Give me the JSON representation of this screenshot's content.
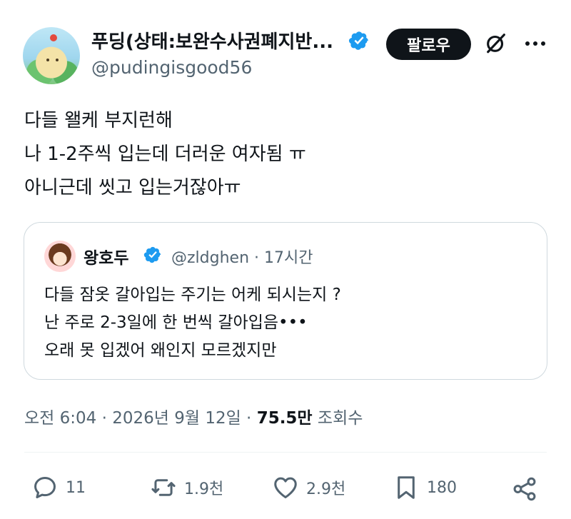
{
  "author": {
    "display_name": "푸딩(상태:보완수사권폐지반...",
    "handle": "@pudingisgood56",
    "verified": true
  },
  "header": {
    "follow_label": "팔로우",
    "grok_icon": "grok-icon",
    "more_icon": "more-icon"
  },
  "post": {
    "lines": [
      "다들 왤케 부지런해",
      "나 1-2주씩 입는데 더러운 여자됨 ㅠ",
      "아니근데 씻고 입는거잖아ㅠ"
    ]
  },
  "quote": {
    "name": "왕호두",
    "handle_time": "@zldghen · 17시간",
    "verified": true,
    "lines": [
      "다들 잠옷 갈아입는 주기는 어케 되시는지 ?",
      "난 주로 2-3일에 한 번씩 갈아입음•••",
      "오래 못 입겠어 왜인지 모르겠지만"
    ]
  },
  "meta": {
    "time": "오전 6:04 · 2026년 9월 12일 · ",
    "views": "75.5만",
    "views_label": " 조회수"
  },
  "actions": {
    "replies": "11",
    "reposts": "1.9천",
    "likes": "2.9천",
    "bookmarks": "180"
  },
  "colors": {
    "verified_blue": "#1d9bf0",
    "text": "#0f1419",
    "muted": "#536471",
    "border": "#cfd9de"
  }
}
